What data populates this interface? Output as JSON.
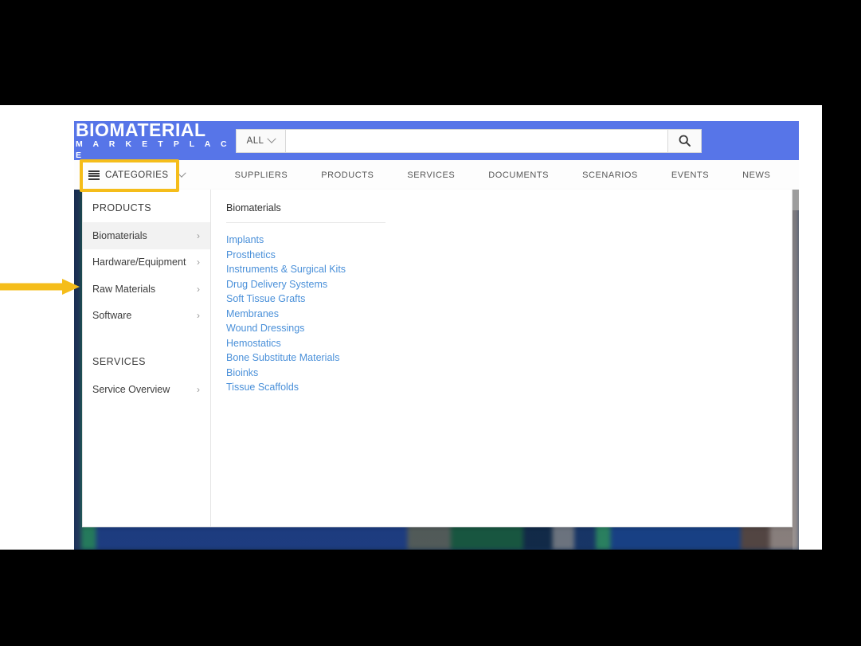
{
  "site": {
    "logo": {
      "line1": "BIOMATERIAL",
      "line2": "M A R K E T P L A C E"
    },
    "search": {
      "scope_label": "ALL",
      "scope_icon": "chevron-down-icon",
      "value": "",
      "placeholder": "",
      "button_icon": "search-icon"
    },
    "nav": {
      "categories_label": "CATEGORIES",
      "categories_icon": "hamburger-icon",
      "categories_chevron": "chevron-down-icon",
      "items": [
        {
          "label": "SUPPLIERS"
        },
        {
          "label": "PRODUCTS"
        },
        {
          "label": "SERVICES"
        },
        {
          "label": "DOCUMENTS"
        },
        {
          "label": "SCENARIOS"
        },
        {
          "label": "EVENTS"
        },
        {
          "label": "NEWS"
        }
      ]
    },
    "dropdown": {
      "products_section_title": "PRODUCTS",
      "products": [
        {
          "label": "Biomaterials",
          "arrow": "›",
          "active": true
        },
        {
          "label": "Hardware/Equipment",
          "arrow": "›",
          "active": false
        },
        {
          "label": "Raw Materials",
          "arrow": "›",
          "active": false
        },
        {
          "label": "Software",
          "arrow": "›",
          "active": false
        }
      ],
      "services_section_title": "SERVICES",
      "services": [
        {
          "label": "Service Overview",
          "arrow": "›",
          "active": false
        }
      ],
      "panel_heading": "Biomaterials",
      "links": [
        {
          "label": "Implants"
        },
        {
          "label": "Prosthetics"
        },
        {
          "label": "Instruments & Surgical Kits"
        },
        {
          "label": "Drug Delivery Systems"
        },
        {
          "label": "Soft Tissue Grafts"
        },
        {
          "label": "Membranes"
        },
        {
          "label": "Wound Dressings"
        },
        {
          "label": "Hemostatics"
        },
        {
          "label": "Bone Substitute Materials"
        },
        {
          "label": "Bioinks"
        },
        {
          "label": "Tissue Scaffolds"
        }
      ]
    }
  },
  "annotation": {
    "arrow_color": "#f5bd1a",
    "highlight_color": "#f5bd1a",
    "target": "CATEGORIES"
  },
  "colors": {
    "header_blue": "#5775e8",
    "link_blue": "#4a90d9",
    "accent_yellow": "#f5bd1a"
  }
}
